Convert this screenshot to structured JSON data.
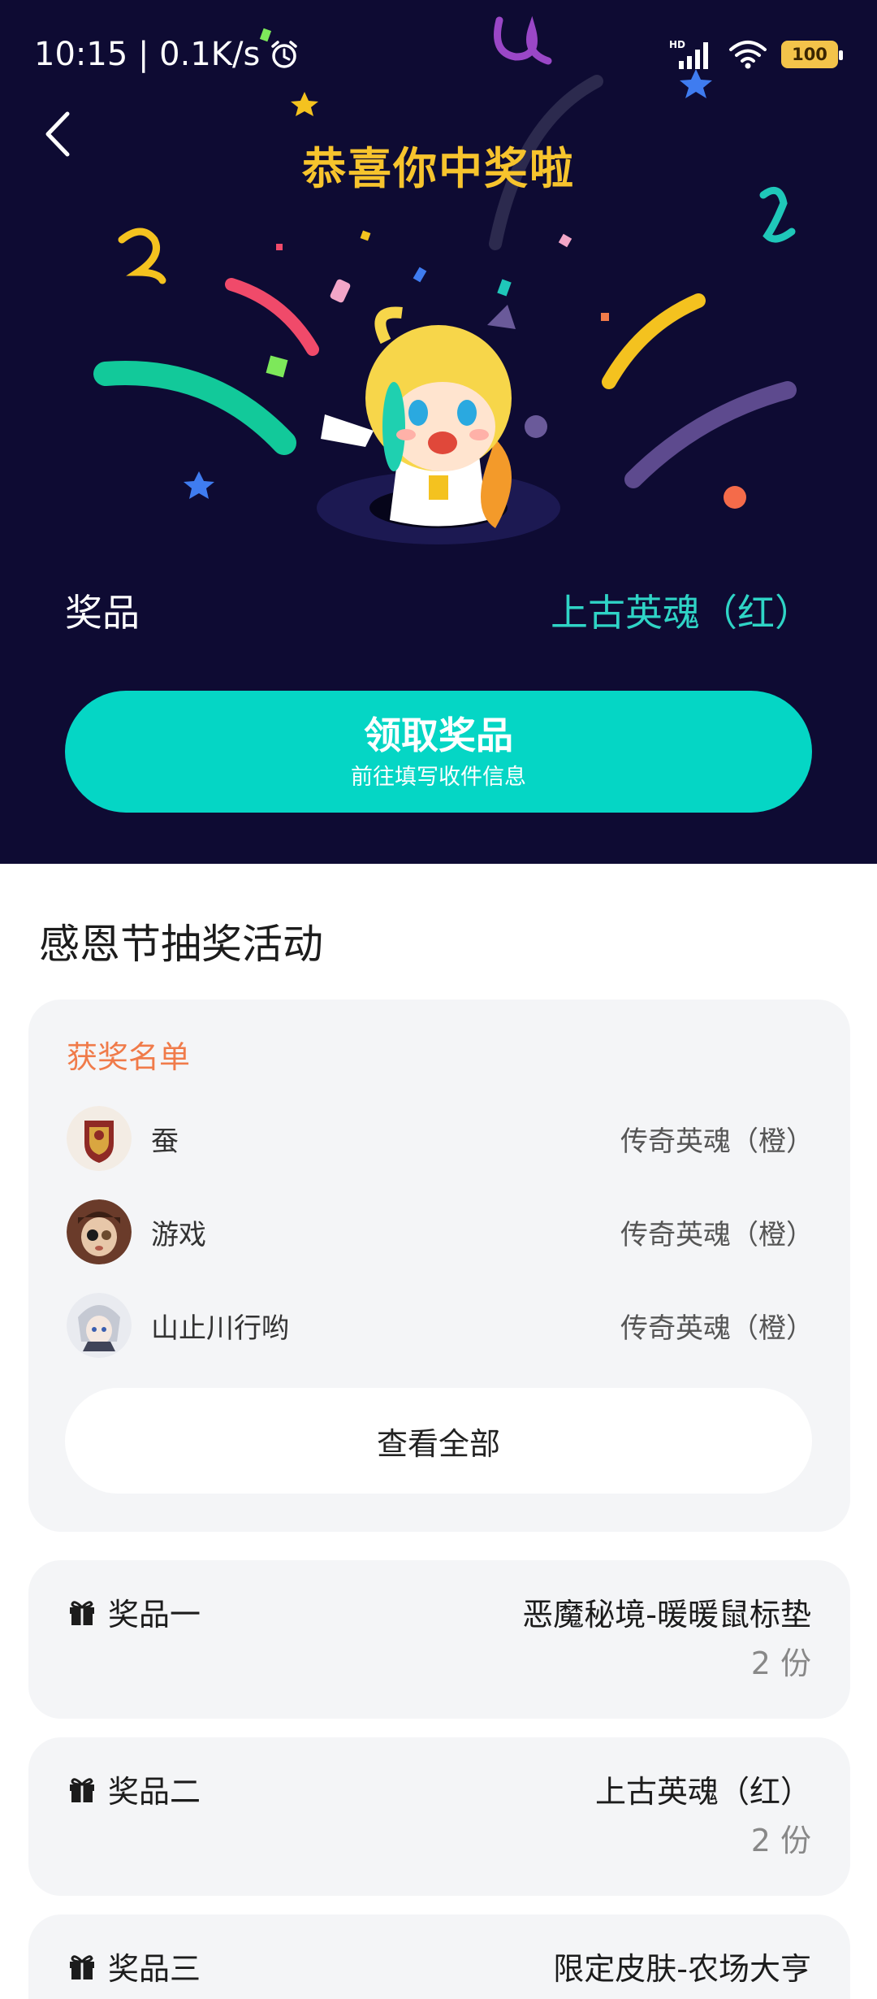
{
  "status_bar": {
    "time": "10:15 | 0.1K/s",
    "network_label": "HD",
    "battery": "100"
  },
  "hero": {
    "title": "恭喜你中奖啦",
    "prize_label": "奖品",
    "prize_value": "上古英魂（红）",
    "claim_button": {
      "label": "领取奖品",
      "sublabel": "前往填写收件信息"
    }
  },
  "activity": {
    "title": "感恩节抽奖活动"
  },
  "winners": {
    "heading": "获奖名单",
    "items": [
      {
        "name": "蚕",
        "prize": "传奇英魂（橙）"
      },
      {
        "name": "游戏",
        "prize": "传奇英魂（橙）"
      },
      {
        "name": "山止川行哟",
        "prize": "传奇英魂（橙）"
      }
    ],
    "view_all": "查看全部"
  },
  "prizes": [
    {
      "label": "奖品一",
      "value": "恶魔秘境-暖暖鼠标垫",
      "count": "2 份"
    },
    {
      "label": "奖品二",
      "value": "上古英魂（红）",
      "count": "2 份"
    },
    {
      "label": "奖品三",
      "value": "限定皮肤-农场大亨"
    }
  ],
  "colors": {
    "hero_bg": "#0e0b33",
    "title_yellow": "#f7c42d",
    "accent_teal": "#05d6c5",
    "winners_heading": "#f07b4a",
    "card_bg": "#f4f5f7"
  }
}
